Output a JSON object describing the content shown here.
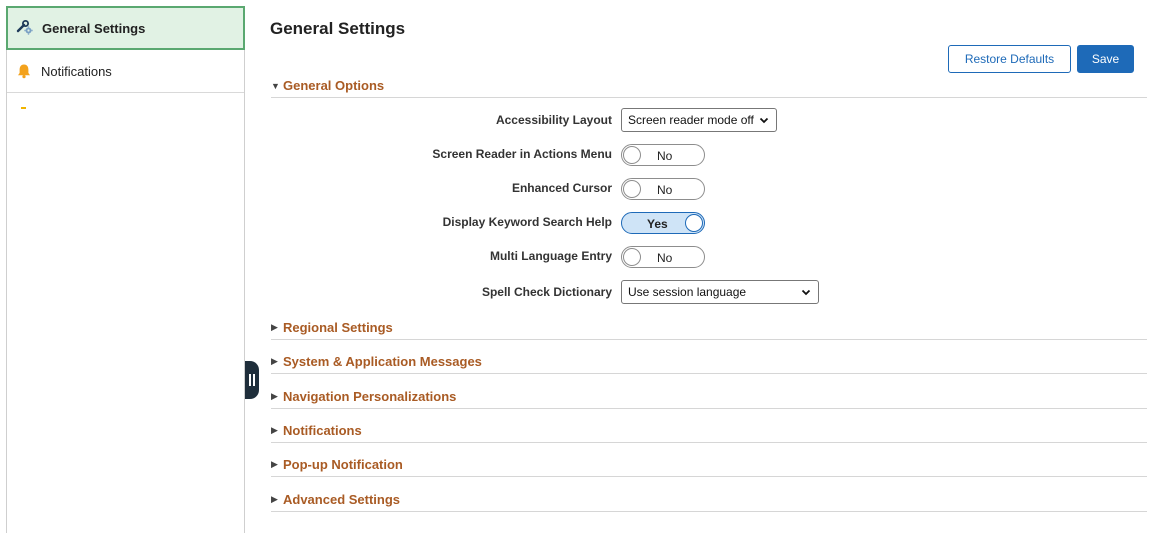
{
  "sidebar": {
    "items": [
      {
        "label": "General Settings",
        "icon": "wrench-gear-icon",
        "active": true
      },
      {
        "label": "Notifications",
        "icon": "bell-icon",
        "active": false
      }
    ]
  },
  "header": {
    "title": "General Settings",
    "restore_label": "Restore Defaults",
    "save_label": "Save"
  },
  "general_options": {
    "title": "General Options",
    "expanded": true,
    "fields": {
      "accessibility_layout": {
        "label": "Accessibility Layout",
        "value": "Screen reader mode off"
      },
      "screen_reader_actions": {
        "label": "Screen Reader in Actions Menu",
        "value": "No"
      },
      "enhanced_cursor": {
        "label": "Enhanced Cursor",
        "value": "No"
      },
      "keyword_search_help": {
        "label": "Display Keyword Search Help",
        "value": "Yes"
      },
      "multi_language_entry": {
        "label": "Multi Language Entry",
        "value": "No"
      },
      "spell_check_dictionary": {
        "label": "Spell Check Dictionary",
        "value": "Use session language"
      }
    }
  },
  "sections": [
    {
      "title": "Regional Settings"
    },
    {
      "title": "System & Application Messages"
    },
    {
      "title": "Navigation Personalizations"
    },
    {
      "title": "Notifications"
    },
    {
      "title": "Pop-up Notification"
    },
    {
      "title": "Advanced Settings"
    }
  ],
  "colors": {
    "accent": "#1e6ab8",
    "section_title": "#a95b24",
    "active_item_bg": "#e1f2e4",
    "active_item_border": "#5aa870"
  }
}
